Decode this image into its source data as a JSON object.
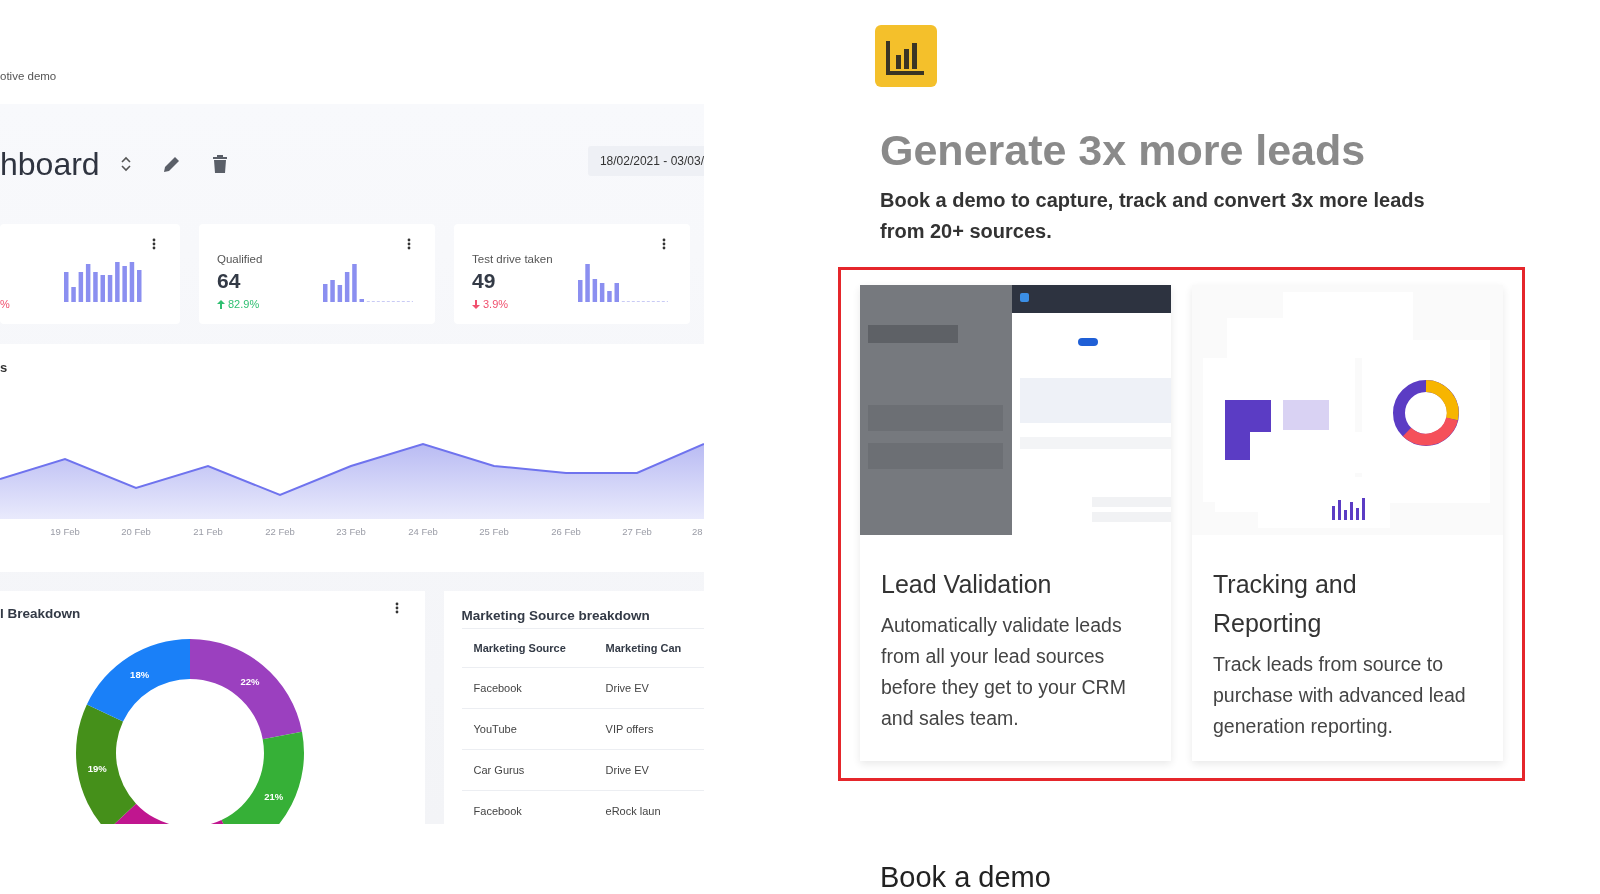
{
  "dashboard": {
    "breadcrumb": "otive demo",
    "title": "hboard",
    "date_range": "18/02/2021 - 03/03/",
    "stats": [
      {
        "change": "%",
        "rising": false,
        "arrow": false
      },
      {
        "title": "Qualified",
        "value": "64",
        "change": "82.9%",
        "rising": true,
        "arrow": true
      },
      {
        "title": "Test drive taken",
        "value": "49",
        "change": "3.9%",
        "rising": false,
        "arrow": true
      }
    ],
    "line_panel": {
      "title": "s",
      "x_labels": [
        "19 Feb",
        "20 Feb",
        "21 Feb",
        "22 Feb",
        "23 Feb",
        "24 Feb",
        "25 Feb",
        "26 Feb",
        "27 Feb",
        "28"
      ]
    },
    "breakdown": {
      "title": "l Breakdown",
      "chart_data": {
        "type": "donut",
        "values": [
          22,
          21,
          20,
          19,
          18
        ],
        "colors": [
          "#9b40bf",
          "#36b037",
          "#c0168f",
          "#45901a",
          "#1a80f8"
        ],
        "value_labels": [
          "22%",
          "21%",
          null,
          "19%",
          "18%"
        ]
      }
    },
    "table": {
      "title": "Marketing Source breakdown",
      "columns": [
        "Marketing Source",
        "Marketing Can"
      ],
      "rows": [
        [
          "Facebook",
          "Drive EV"
        ],
        [
          "YouTube",
          "VIP offers"
        ],
        [
          "Car Gurus",
          "Drive EV"
        ],
        [
          "Facebook",
          "eRock laun"
        ]
      ]
    }
  },
  "landing": {
    "headline": "Generate 3x more leads",
    "subhead": "Book a demo to capture, track and convert 3x more leads from 20+ sources.",
    "features_highlighted": true,
    "features": [
      {
        "kind": "validation",
        "title": "Lead Validation",
        "body": "Automatically validate leads from all your lead sources before they get to your CRM and sales team."
      },
      {
        "kind": "reporting",
        "title": "Tracking and Reporting",
        "body": "Track leads from source to purchase with advanced lead generation reporting."
      }
    ],
    "cta_heading": "Book a demo"
  }
}
